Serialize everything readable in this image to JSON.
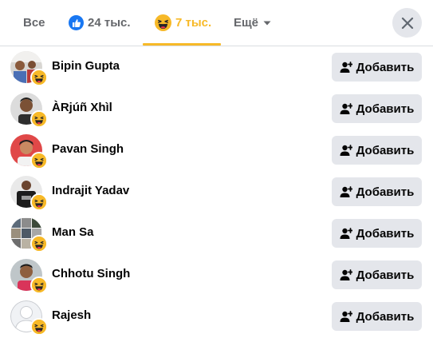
{
  "tabs": {
    "all_label": "Все",
    "like_count": "24 тыс.",
    "haha_count": "7 тыс.",
    "more_label": "Ещё"
  },
  "colors": {
    "haha_yellow": "#f7b928",
    "like_blue": "#1877f2",
    "button_gray": "#e4e6eb"
  },
  "people": [
    {
      "name": "Bipin Gupta",
      "reaction_icon": "haha-icon",
      "action": "Добавить"
    },
    {
      "name": "ÀRjúñ Xhìl",
      "reaction_icon": "haha-icon",
      "action": "Добавить"
    },
    {
      "name": "Pavan Singh",
      "reaction_icon": "haha-icon",
      "action": "Добавить"
    },
    {
      "name": "Indrajit Yadav",
      "reaction_icon": "haha-icon",
      "action": "Добавить"
    },
    {
      "name": "Man Sa",
      "reaction_icon": "haha-icon",
      "action": "Добавить"
    },
    {
      "name": "Chhotu Singh",
      "reaction_icon": "haha-icon",
      "action": "Добавить"
    },
    {
      "name": "Rajesh",
      "reaction_icon": "haha-icon",
      "action": "Добавить"
    }
  ]
}
